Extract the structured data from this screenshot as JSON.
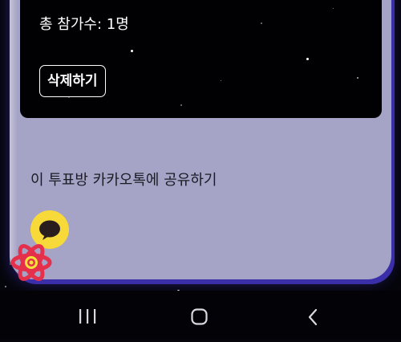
{
  "poll": {
    "total_participants_label": "총 참가수: 1명",
    "delete_button_label": "삭제하기"
  },
  "share": {
    "text": "이 투표방 카카오톡에 공유하기",
    "kakao_icon": "kakao-talk-speech-bubble-icon"
  },
  "overlay": {
    "icon": "react-atom-logo-icon"
  },
  "nav_bar": {
    "recent_apps_icon": "recent-apps-icon",
    "home_icon": "home-icon",
    "back_icon": "back-icon"
  },
  "colors": {
    "panel": "#a5a3c6",
    "panel_glow": "#3a2fa8",
    "card": "#010103",
    "kakao_yellow": "#f8d93a",
    "react_red": "#e5304b",
    "react_yellow": "#f2e23a",
    "nav_background": "#020207"
  }
}
